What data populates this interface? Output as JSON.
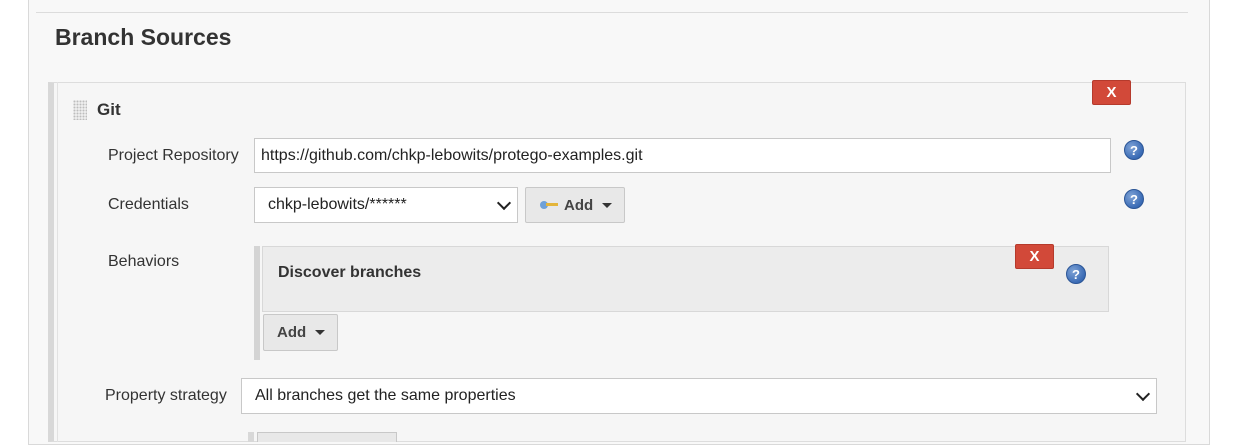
{
  "section": {
    "title": "Branch Sources"
  },
  "git": {
    "title": "Git",
    "delete_label": "X"
  },
  "form": {
    "project_repository": {
      "label": "Project Repository",
      "value": "https://github.com/chkp-lebowits/protego-examples.git"
    },
    "credentials": {
      "label": "Credentials",
      "selected": "chkp-lebowits/******",
      "add_label": "Add",
      "add_icon": "key-icon"
    },
    "behaviors": {
      "label": "Behaviors",
      "items": [
        {
          "title": "Discover branches",
          "delete_label": "X"
        }
      ],
      "add_label": "Add"
    },
    "property_strategy": {
      "label": "Property strategy",
      "selected": "All branches get the same properties"
    }
  },
  "help_icon": "?",
  "colors": {
    "delete_button": "#d24939",
    "help_icon": "#3a6bb5",
    "panel_bg": "#f6f6f6"
  }
}
